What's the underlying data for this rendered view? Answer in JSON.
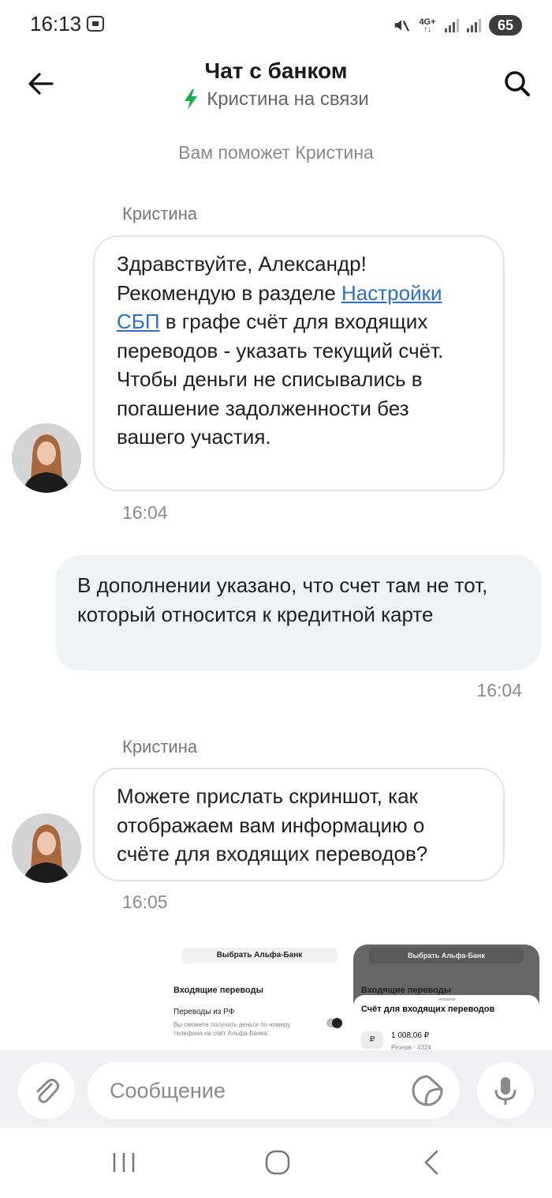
{
  "status_bar": {
    "time": "16:13",
    "network": "4G+",
    "battery": "65"
  },
  "header": {
    "title": "Чат с банком",
    "subtitle": "Кристина на связи",
    "accent_color": "#12b24a"
  },
  "system_note": "Вам поможет Кристина",
  "messages": [
    {
      "sender": "Кристина",
      "text_before_link": "Здравствуйте, Александр! Рекомендую в разделе ",
      "link_text": "Настройки СБП",
      "text_after_link": " в графе счёт для входящих переводов - указать текущий счёт.",
      "text_line2": "Чтобы деньги не списывались в погашение задолженности без вашего участия.",
      "time": "16:04"
    },
    {
      "text": "В дополнении указано, что счет там не тот, который относится к кредитной карте",
      "time": "16:04"
    },
    {
      "sender": "Кристина",
      "text": "Можете прислать скриншот, как отображаем вам информацию о счёте для входящих переводов?",
      "time": "16:05"
    }
  ],
  "attachment": {
    "left": {
      "button": "Выбрать Альфа-Банк",
      "heading": "Входящие переводы",
      "item_title": "Переводы из РФ",
      "item_desc": "Вы сможете получать деньги по номеру телефона на счёт Альфа-Банка"
    },
    "right": {
      "button": "Выбрать Альфа-Банк",
      "heading": "Входящие переводы",
      "sheet_title": "Счёт для входящих переводов",
      "currency": "₽",
      "amount": "1 008,06 ₽",
      "reserve": "Резерв · 4324"
    }
  },
  "composer": {
    "placeholder": "Сообщение"
  },
  "icons": {
    "back": "arrow-left",
    "search": "magnifier",
    "attach": "paperclip",
    "sticker": "sticker",
    "mic": "microphone",
    "online": "lightning-bolt"
  }
}
